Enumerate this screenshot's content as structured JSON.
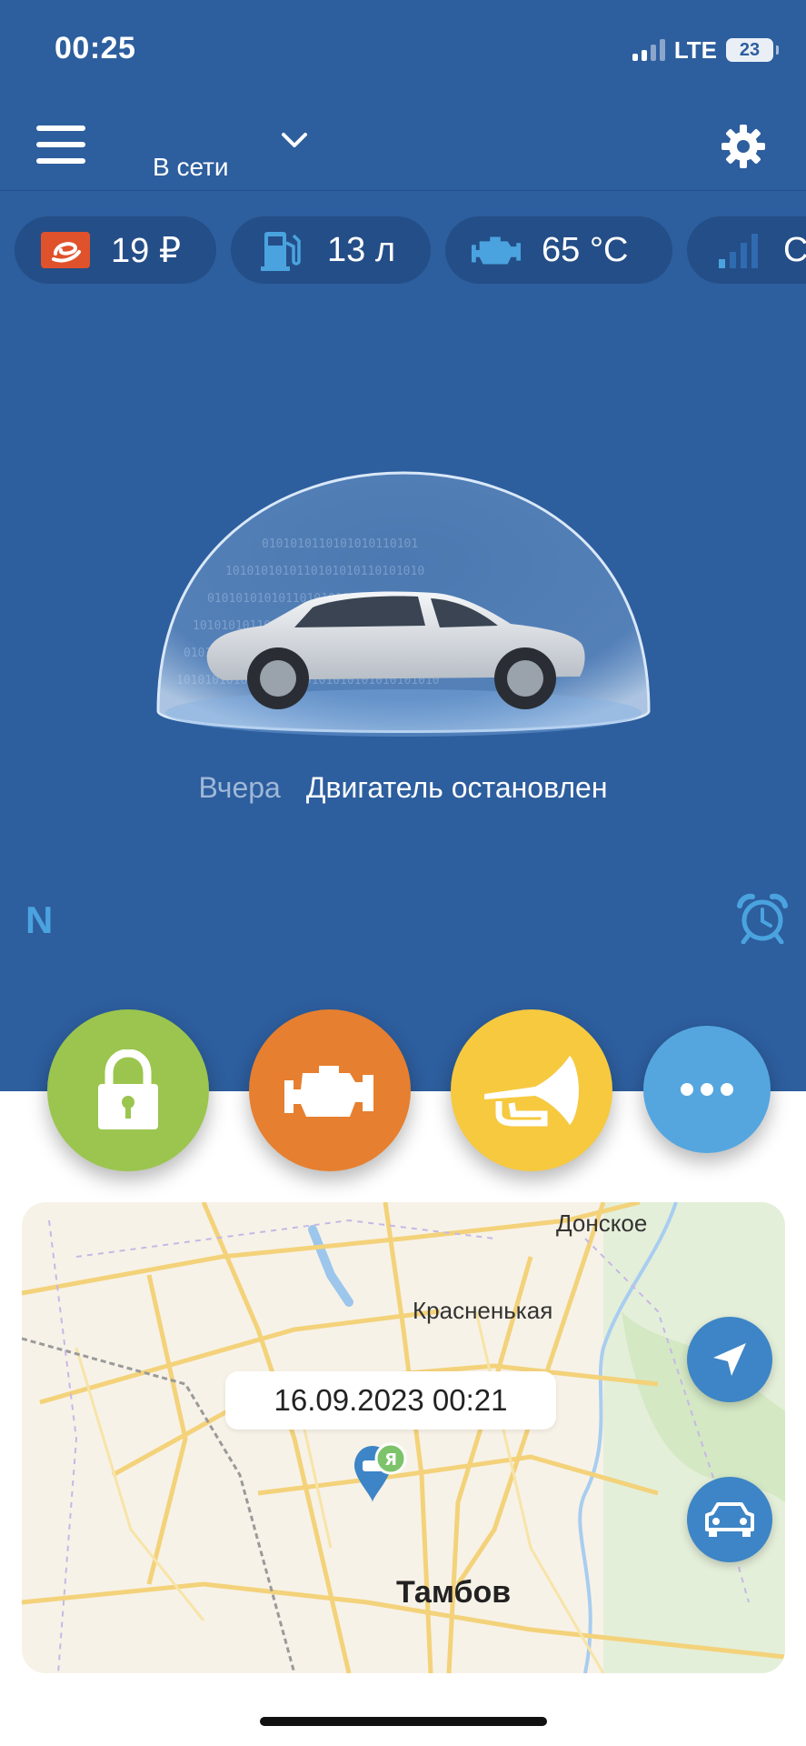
{
  "status_bar": {
    "time": "00:25",
    "network": "LTE",
    "battery": "23"
  },
  "header": {
    "connection_status": "В сети"
  },
  "pills": [
    {
      "icon": "balance-icon",
      "value": "19 ₽"
    },
    {
      "icon": "fuel-pump-icon",
      "value": "13 л"
    },
    {
      "icon": "engine-temp-icon",
      "value": "65 °C"
    },
    {
      "icon": "signal-strength-icon",
      "value": "С"
    }
  ],
  "car_status": {
    "when": "Вчера",
    "engine_state": "Двигатель остановлен"
  },
  "compass": "N",
  "actions": [
    {
      "name": "lock",
      "color": "#9bc54e"
    },
    {
      "name": "engine",
      "color": "#e67f2f"
    },
    {
      "name": "horn",
      "color": "#f6c93f"
    },
    {
      "name": "more",
      "color": "#55a6df"
    }
  ],
  "map": {
    "labels": {
      "donskoe": "Донское",
      "krasnenkaya": "Красненькая",
      "tambov": "Тамбов"
    },
    "timestamp": "16.09.2023 00:21",
    "pin_badge": "Я"
  },
  "colors": {
    "primary_blue": "#2d5e9e",
    "pill_bg": "#244e87",
    "accent_light_blue": "#4aa3df"
  }
}
